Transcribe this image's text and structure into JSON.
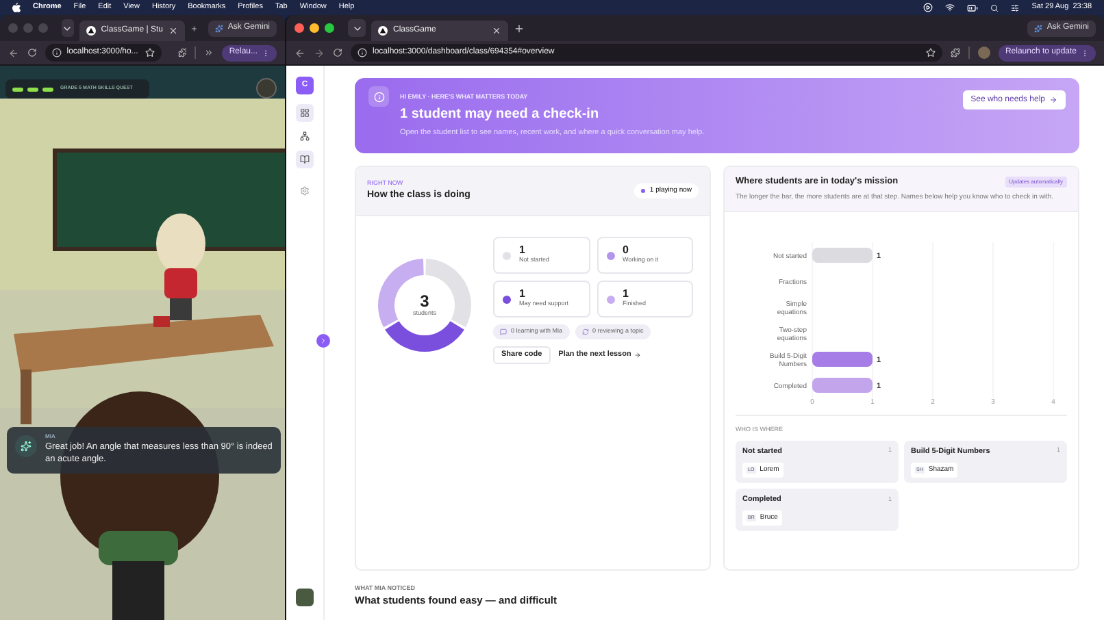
{
  "menu_bar": {
    "app": "Chrome",
    "menus": [
      "File",
      "Edit",
      "View",
      "History",
      "Bookmarks",
      "Profiles",
      "Tab",
      "Window",
      "Help"
    ],
    "clock": "Sat 29 Aug  23:38"
  },
  "game_window": {
    "tab": "ClassGame | Stu",
    "gemini": "Ask Gemini",
    "url": "localhost:3000/ho...",
    "relaunch": "Relau...",
    "hud": {
      "title": "GRADE 5 MATH SKILLS QUEST",
      "segments": [
        {
          "done": true
        },
        {
          "done": true
        },
        {
          "done": true
        }
      ]
    },
    "chat": {
      "speaker": "MIA",
      "message": "Great job! An angle that measures less than 90° is indeed an acute angle."
    }
  },
  "dashboard_window": {
    "tab": "ClassGame",
    "gemini": "Ask Gemini",
    "url": "localhost:3000/dashboard/class/694354#overview",
    "relaunch": "Relaunch to update",
    "sidebar": {
      "logo": "C",
      "items": [
        {
          "kind": "grid",
          "selected": true
        },
        {
          "kind": "network",
          "selected": false
        },
        {
          "kind": "book",
          "selected": true
        },
        {
          "kind": "settings",
          "selected": false
        }
      ]
    },
    "banner": {
      "eyebrow": "HI EMILY · HERE'S WHAT MATTERS TODAY",
      "title": "1 student may need a check-in",
      "text": "Open the student list to see names, recent work, and where a quick conversation may help.",
      "button": "See who needs help"
    },
    "class_card": {
      "eyebrow": "RIGHT NOW",
      "title": "How the class is doing",
      "live": "1 playing now",
      "total": "3",
      "total_label": "students",
      "stats": [
        {
          "count": "1",
          "label": "Not started",
          "color": "#e2e1e6"
        },
        {
          "count": "0",
          "label": "Working on it",
          "color": "#b595ec"
        },
        {
          "count": "1",
          "label": "May need support",
          "color": "#7b4fde"
        },
        {
          "count": "1",
          "label": "Finished",
          "color": "#c6aef0"
        }
      ],
      "chips": [
        {
          "kind": "chat",
          "label": "0 learning with Mia"
        },
        {
          "kind": "review",
          "label": "0 reviewing a topic"
        }
      ],
      "share": "Share code",
      "plan": "Plan the next lesson"
    },
    "mission_card": {
      "title": "Where students are in today's mission",
      "badge": "Updates automatically",
      "text": "The longer the bar, the more students are at that step. Names below help you know who to check in with.",
      "chart_data": {
        "type": "bar",
        "orientation": "horizontal",
        "stacked": true,
        "data_labels": true,
        "grid": true,
        "categories": [
          "Not started",
          "Fractions",
          "Simple equations",
          "Two-step equations",
          "Build 5-Digit Numbers",
          "Completed"
        ],
        "xlim": [
          0,
          4
        ],
        "xticks": [
          0,
          1,
          2,
          3,
          4
        ],
        "series": [
          {
            "color": "#dcdbe0",
            "values": [
              1,
              null,
              null,
              null,
              null,
              null
            ]
          },
          {
            "color": "#a67ce6",
            "values": [
              null,
              null,
              null,
              null,
              1,
              null
            ]
          },
          {
            "color": "#c3a5ec",
            "values": [
              null,
              null,
              null,
              null,
              null,
              1
            ]
          }
        ]
      },
      "groups_label": "WHO IS WHERE",
      "groups": [
        {
          "title": "Not started",
          "count": "1",
          "students": [
            {
              "initials": "LO",
              "name": "Lorem"
            }
          ]
        },
        {
          "title": "Build 5-Digit Numbers",
          "count": "1",
          "students": [
            {
              "initials": "SH",
              "name": "Shazam"
            }
          ]
        },
        {
          "title": "Completed",
          "count": "1",
          "students": [
            {
              "initials": "BR",
              "name": "Bruce"
            }
          ]
        }
      ]
    },
    "noticed": {
      "eyebrow": "WHAT MIA NOTICED",
      "title": "What students found easy — and difficult"
    }
  }
}
